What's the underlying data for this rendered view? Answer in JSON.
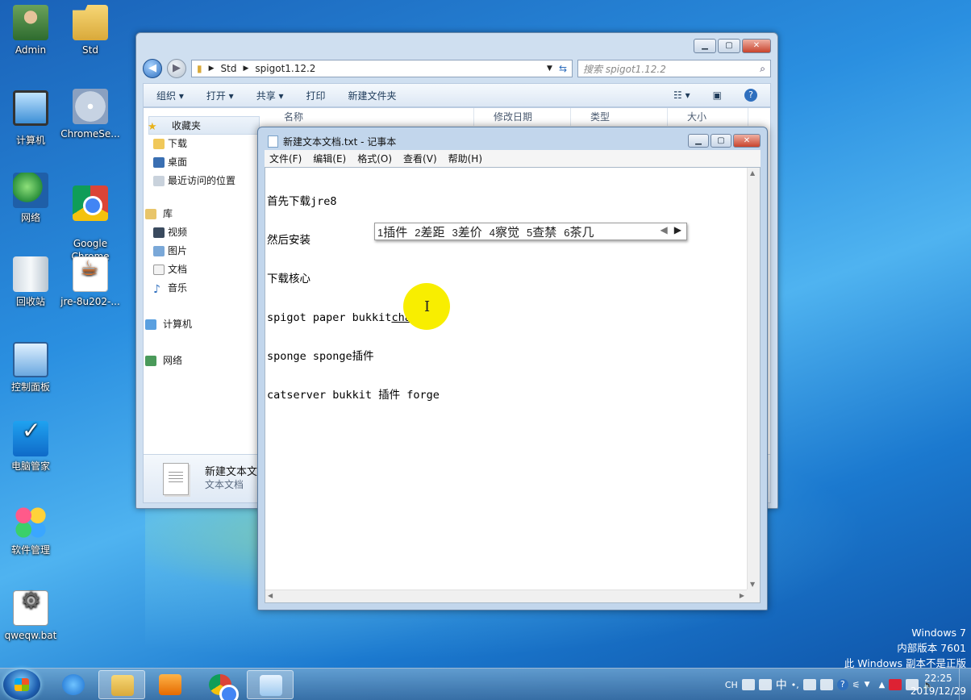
{
  "desktop": {
    "icons": [
      {
        "label": "Admin"
      },
      {
        "label": "Std"
      },
      {
        "label": "计算机"
      },
      {
        "label": "ChromeSe..."
      },
      {
        "label": "网络"
      },
      {
        "label": "Google\nChrome"
      },
      {
        "label": "回收站"
      },
      {
        "label": "jre-8u202-..."
      },
      {
        "label": "控制面板"
      },
      {
        "label": "电脑管家"
      },
      {
        "label": "软件管理"
      },
      {
        "label": "qweqw.bat"
      }
    ]
  },
  "explorer": {
    "breadcrumb": [
      "Std",
      "spigot1.12.2"
    ],
    "search_placeholder": "搜索 spigot1.12.2",
    "toolbar": [
      "组织 ▾",
      "打开 ▾",
      "共享 ▾",
      "打印",
      "新建文件夹"
    ],
    "nav": {
      "favorites": "收藏夹",
      "downloads": "下载",
      "desktop": "桌面",
      "recent": "最近访问的位置",
      "libraries": "库",
      "videos": "视频",
      "pictures": "图片",
      "documents": "文档",
      "music": "音乐",
      "computer": "计算机",
      "network": "网络"
    },
    "columns": [
      "名称",
      "修改日期",
      "类型",
      "大小"
    ],
    "details": {
      "name": "新建文本文",
      "type": "文本文档"
    }
  },
  "notepad": {
    "title": "新建文本文档.txt - 记事本",
    "menu": [
      "文件(F)",
      "编辑(E)",
      "格式(O)",
      "查看(V)",
      "帮助(H)"
    ],
    "lines": {
      "l1": "首先下载jre8",
      "l2": "然后安装",
      "l3": "下载核心",
      "l4_prefix": "spigot paper bukkit",
      "l4_composing": "chaj",
      "l5": "sponge sponge插件",
      "l6": "catserver bukkit 插件 forge"
    }
  },
  "ime": {
    "candidates": [
      {
        "num": "1",
        "text": "插件"
      },
      {
        "num": "2",
        "text": "差距"
      },
      {
        "num": "3",
        "text": "差价"
      },
      {
        "num": "4",
        "text": "察觉"
      },
      {
        "num": "5",
        "text": "查禁"
      },
      {
        "num": "6",
        "text": "茶几"
      }
    ]
  },
  "watermark": {
    "line1": "Windows 7",
    "line2": "内部版本 7601",
    "line3": "此 Windows 副本不是正版"
  },
  "taskbar": {
    "tray_lang": "CH",
    "tray_ime": "中",
    "time": "22:25",
    "date": "2019/12/29"
  }
}
